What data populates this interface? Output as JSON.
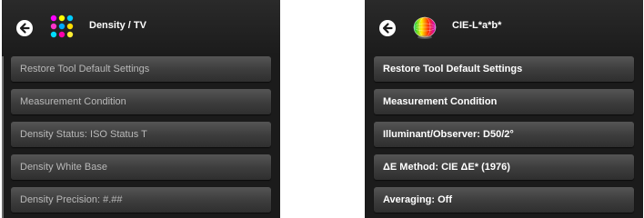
{
  "left_panel": {
    "title": "Density / TV",
    "icons": {
      "back": "back-arrow-icon",
      "tool": "density-dots-icon"
    },
    "menu": [
      "Restore Tool Default Settings",
      "Measurement Condition",
      "Density Status: ISO Status T",
      "Density White Base",
      "Density Precision: #.##"
    ]
  },
  "right_panel": {
    "title": "CIE-L*a*b*",
    "icons": {
      "back": "back-arrow-icon",
      "tool": "color-sphere-icon"
    },
    "menu": [
      "Restore Tool Default Settings",
      "Measurement Condition",
      "Illuminant/Observer: D50/2°",
      "ΔE Method: CIE ΔE* (1976)",
      "Averaging: Off"
    ]
  },
  "colors": {
    "panel_bg": "#1b1b1b",
    "button_top": "#555555",
    "button_bottom": "#2f2f2f",
    "dim_text": "#b9b9b9",
    "bright_text": "#ffffff"
  }
}
